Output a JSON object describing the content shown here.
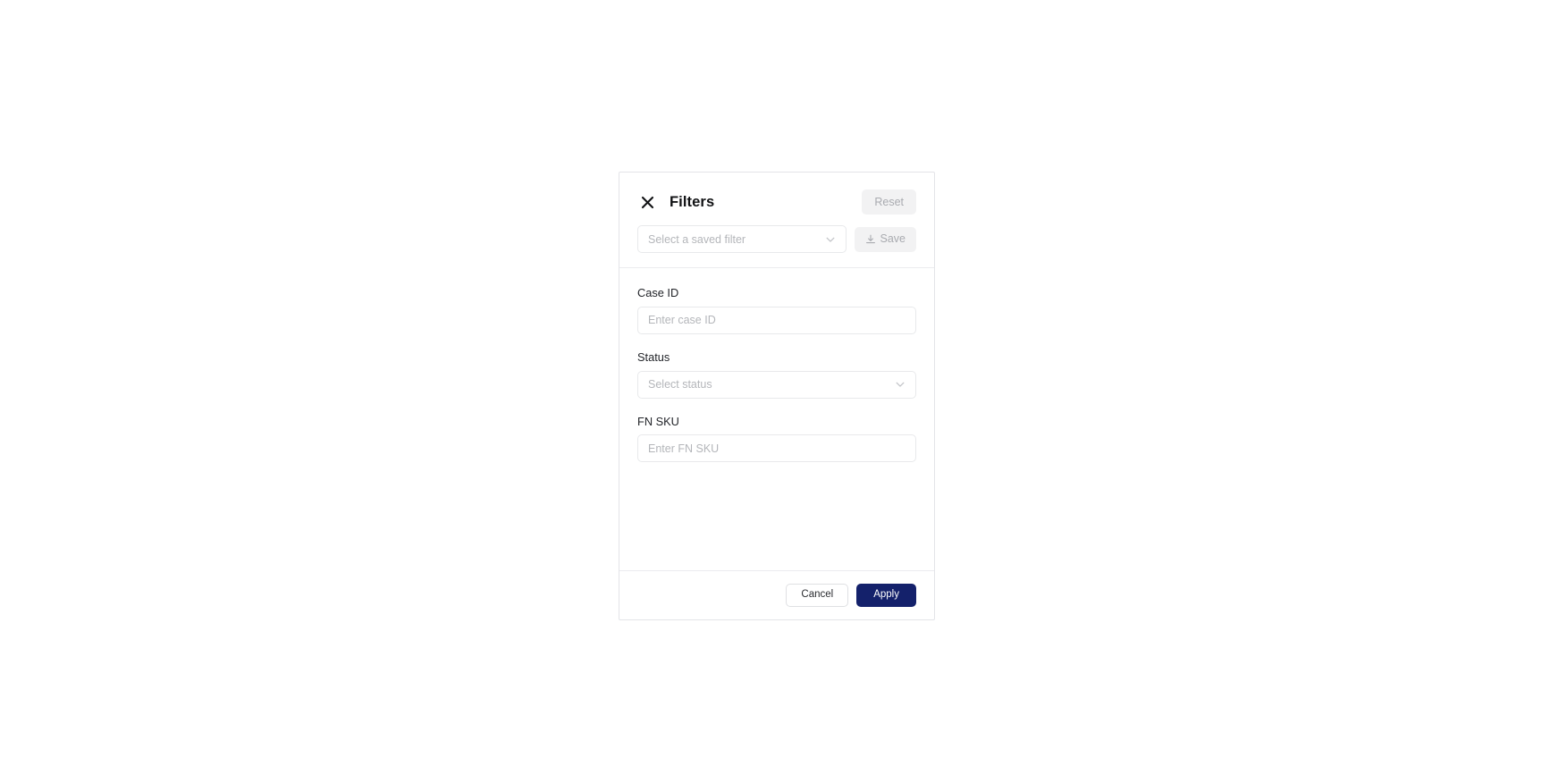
{
  "colors": {
    "apply_button": "#14216b",
    "panel_border": "#e3e4e8",
    "divider": "#ebecef",
    "input_border": "#e8e9eb",
    "placeholder_text": "#b4b6ba",
    "disabled_button_bg": "#f2f2f3",
    "disabled_button_text": "#a9abb0",
    "label_text": "#222429",
    "title_text": "#111214",
    "page_background": "#ffffff"
  },
  "panel": {
    "header": {
      "title": "Filters",
      "close_icon": "close-icon",
      "reset_label": "Reset",
      "saved_filter": {
        "placeholder": "Select a saved filter",
        "value": "",
        "chevron_icon": "chevron-down-icon"
      },
      "save_label": "Save",
      "save_icon": "save-download-icon"
    },
    "fields": [
      {
        "id": "case-id",
        "label": "Case ID",
        "type": "text",
        "placeholder": "Enter case ID",
        "value": ""
      },
      {
        "id": "status",
        "label": "Status",
        "type": "select",
        "placeholder": "Select status",
        "value": "",
        "chevron_icon": "chevron-down-icon"
      },
      {
        "id": "fn-sku",
        "label": "FN SKU",
        "type": "text",
        "placeholder": "Enter FN SKU",
        "value": ""
      }
    ],
    "footer": {
      "cancel_label": "Cancel",
      "apply_label": "Apply"
    }
  }
}
